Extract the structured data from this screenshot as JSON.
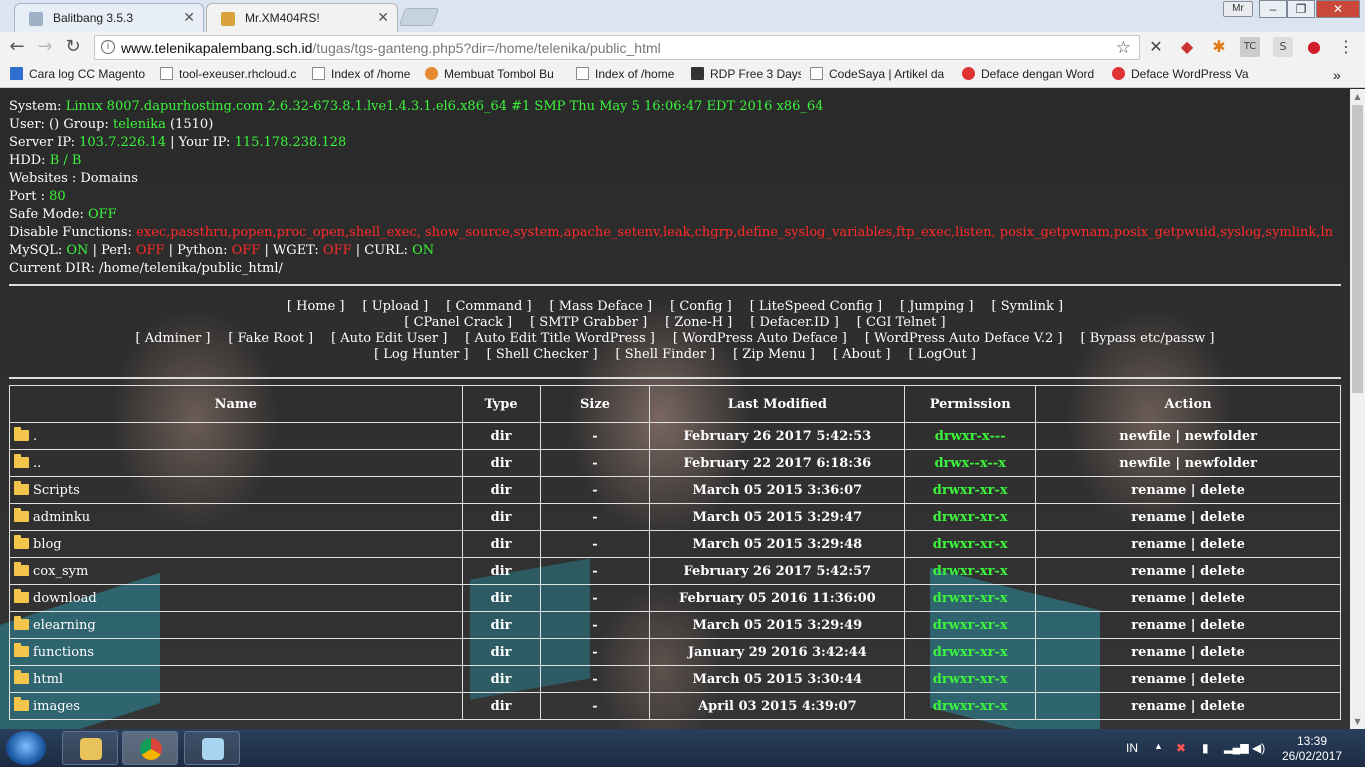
{
  "browser": {
    "tabs": [
      {
        "label": "Balitbang 3.5.3",
        "active": false
      },
      {
        "label": "Mr.XM404RS!",
        "active": true
      }
    ],
    "profile_label": "Mr",
    "window_controls": {
      "minimize": "–",
      "maximize": "❐",
      "close": "✕"
    },
    "url_host": "www.telenikapalembang.sch.id",
    "url_path": "/tugas/tgs-ganteng.php5?dir=/home/telenika/public_html",
    "bookmarks": [
      {
        "label": "Cara log CC Magento",
        "icon": "page-icon"
      },
      {
        "label": "tool-exeuser.rhcloud.c",
        "icon": "page-icon"
      },
      {
        "label": "Index of /home",
        "icon": "page-icon"
      },
      {
        "label": "Membuat Tombol Bu",
        "icon": "heart-icon"
      },
      {
        "label": "Index of /home",
        "icon": "page-icon"
      },
      {
        "label": "RDP Free 3 Days",
        "icon": "rdp-icon"
      },
      {
        "label": "CodeSaya | Artikel da",
        "icon": "code-icon"
      },
      {
        "label": "Deface dengan Word",
        "icon": "red-dot-icon"
      },
      {
        "label": "Deface WordPress Va",
        "icon": "red-dot-icon"
      }
    ],
    "bookmarks_more": "»"
  },
  "server_info": {
    "system_label": "System:",
    "system_value": "Linux 8007.dapurhosting.com 2.6.32-673.8.1.lve1.4.3.1.el6.x86_64 #1 SMP Thu May 5 16:06:47 EDT 2016 x86_64",
    "user_label": "User: () Group:",
    "group_value": "telenika",
    "group_id": "(1510)",
    "server_ip_label": "Server IP:",
    "server_ip": "103.7.226.14",
    "your_ip_label": "| Your IP:",
    "your_ip": "115.178.238.128",
    "hdd_label": "HDD:",
    "hdd_value": "B / B",
    "websites_label": "Websites : Domains",
    "port_label": "Port :",
    "port_value": "80",
    "safe_mode_label": "Safe Mode:",
    "safe_mode_value": "OFF",
    "disable_functions_label": "Disable Functions:",
    "disable_functions_value": "exec,passthru,popen,proc_open,shell_exec, show_source,system,apache_setenv,leak,chgrp,define_syslog_variables,ftp_exec,listen, posix_getpwnam,posix_getpwuid,syslog,symlink,ln",
    "mysql_label": "MySQL:",
    "mysql_value": "ON",
    "perl_label": "| Perl:",
    "perl_value": "OFF",
    "python_label": "| Python:",
    "python_value": "OFF",
    "wget_label": "| WGET:",
    "wget_value": "OFF",
    "curl_label": "| CURL:",
    "curl_value": "ON",
    "current_dir_label": "Current DIR: /home/telenika/public_html/"
  },
  "menu_rows": [
    [
      "[ Home ]",
      "[ Upload ]",
      "[ Command ]",
      "[ Mass Deface ]",
      "[ Config ]",
      "[ LiteSpeed Config ]",
      "[ Jumping ]",
      "[ Symlink ]"
    ],
    [
      "[ CPanel Crack ]",
      "[ SMTP Grabber ]",
      "[ Zone-H ]",
      "[ Defacer.ID ]",
      "[ CGI Telnet ]"
    ],
    [
      "[ Adminer ]",
      "[ Fake Root ]",
      "[ Auto Edit User ]",
      "[ Auto Edit Title WordPress ]",
      "[ WordPress Auto Deface ]",
      "[ WordPress Auto Deface V.2 ]",
      "[ Bypass etc/passw ]"
    ],
    [
      "[ Log Hunter ]",
      "[ Shell Checker ]",
      "[ Shell Finder ]",
      "[ Zip Menu ]",
      "[ About ]",
      "[ LogOut ]"
    ]
  ],
  "file_table": {
    "headers": [
      "Name",
      "Type",
      "Size",
      "Last Modified",
      "Permission",
      "Action"
    ],
    "rows": [
      {
        "name": ".",
        "type": "dir",
        "size": "-",
        "modified": "February 26 2017 5:42:53",
        "perm": "drwxr-x---",
        "a1": "newfile",
        "a2": "newfolder"
      },
      {
        "name": "..",
        "type": "dir",
        "size": "-",
        "modified": "February 22 2017 6:18:36",
        "perm": "drwx--x--x",
        "a1": "newfile",
        "a2": "newfolder"
      },
      {
        "name": "Scripts",
        "type": "dir",
        "size": "-",
        "modified": "March 05 2015 3:36:07",
        "perm": "drwxr-xr-x",
        "a1": "rename",
        "a2": "delete"
      },
      {
        "name": "adminku",
        "type": "dir",
        "size": "-",
        "modified": "March 05 2015 3:29:47",
        "perm": "drwxr-xr-x",
        "a1": "rename",
        "a2": "delete"
      },
      {
        "name": "blog",
        "type": "dir",
        "size": "-",
        "modified": "March 05 2015 3:29:48",
        "perm": "drwxr-xr-x",
        "a1": "rename",
        "a2": "delete"
      },
      {
        "name": "cox_sym",
        "type": "dir",
        "size": "-",
        "modified": "February 26 2017 5:42:57",
        "perm": "drwxr-xr-x",
        "a1": "rename",
        "a2": "delete"
      },
      {
        "name": "download",
        "type": "dir",
        "size": "-",
        "modified": "February 05 2016 11:36:00",
        "perm": "drwxr-xr-x",
        "a1": "rename",
        "a2": "delete"
      },
      {
        "name": "elearning",
        "type": "dir",
        "size": "-",
        "modified": "March 05 2015 3:29:49",
        "perm": "drwxr-xr-x",
        "a1": "rename",
        "a2": "delete"
      },
      {
        "name": "functions",
        "type": "dir",
        "size": "-",
        "modified": "January 29 2016 3:42:44",
        "perm": "drwxr-xr-x",
        "a1": "rename",
        "a2": "delete"
      },
      {
        "name": "html",
        "type": "dir",
        "size": "-",
        "modified": "March 05 2015 3:30:44",
        "perm": "drwxr-xr-x",
        "a1": "rename",
        "a2": "delete"
      },
      {
        "name": "images",
        "type": "dir",
        "size": "-",
        "modified": "April 03 2015 4:39:07",
        "perm": "drwxr-xr-x",
        "a1": "rename",
        "a2": "delete"
      }
    ]
  },
  "taskbar": {
    "language": "IN",
    "time": "13:39",
    "date": "26/02/2017"
  }
}
